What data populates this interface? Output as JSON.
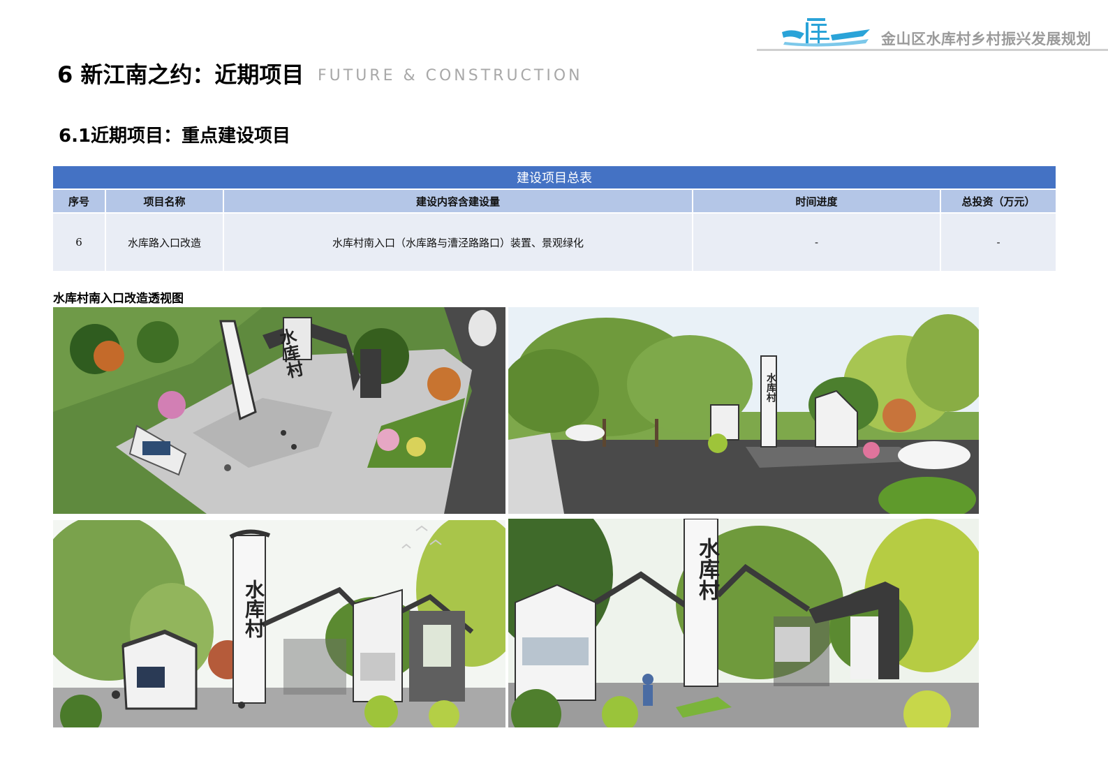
{
  "header": {
    "logo_icon": "water-reservoir-logo-icon",
    "brand_color": "#2aa3d8",
    "plan_title": "金山区水库村乡村振兴发展规划"
  },
  "page": {
    "title": "6 新江南之约：近期项目",
    "subtitle": "FUTURE & CONSTRUCTION",
    "section_title": "6.1近期项目：重点建设项目"
  },
  "table": {
    "caption": "建设项目总表",
    "header_color": "#4472c4",
    "subheader_color": "#b4c6e7",
    "columns": [
      "序号",
      "项目名称",
      "建设内容含建设量",
      "时间进度",
      "总投资（万元）"
    ],
    "rows": [
      [
        "6",
        "水库路入口改造",
        "水库村南入口（水库路与漕泾路路口）装置、景观绿化",
        "-",
        "-"
      ]
    ]
  },
  "figure": {
    "caption": "水库村南入口改造透视图",
    "sign_text": "水库村",
    "panels": [
      {
        "name": "aerial-view-render"
      },
      {
        "name": "street-view-render"
      },
      {
        "name": "gate-front-view-render"
      },
      {
        "name": "gate-close-view-render"
      }
    ]
  }
}
